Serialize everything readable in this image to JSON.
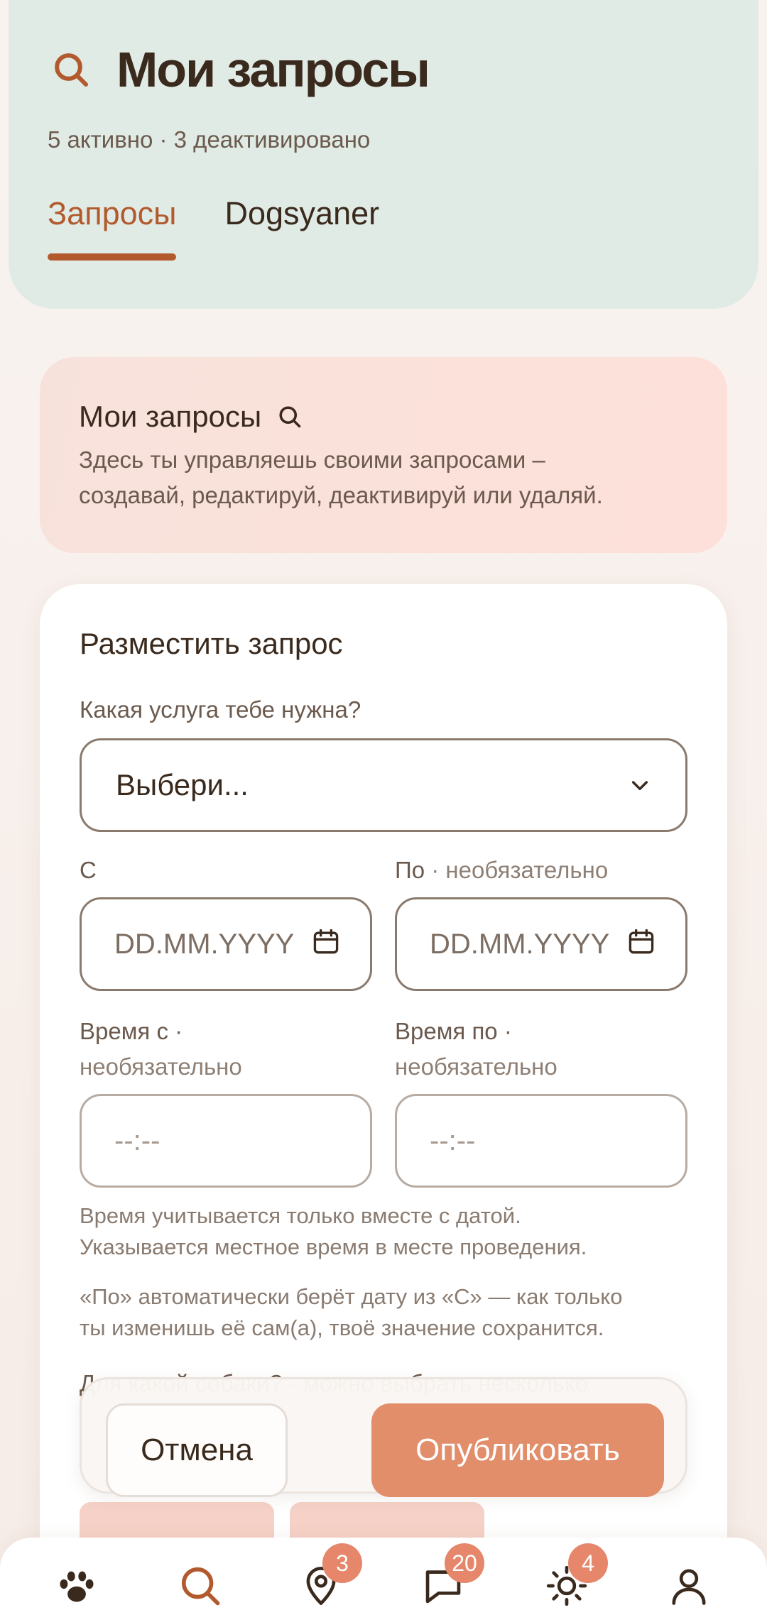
{
  "header": {
    "title": "Мои запросы",
    "subtitle": "5 активно · 3 деактивировано",
    "tabs": [
      {
        "label": "Запросы",
        "active": true
      },
      {
        "label": "Dogsyaner",
        "active": false
      }
    ]
  },
  "info": {
    "title": "Мои запросы",
    "text_line1": "Здесь ты управляешь своими запросами –",
    "text_line2": "создавай, редактируй, деактивируй или удаляй."
  },
  "form": {
    "title": "Разместить запрос",
    "service_label": "Какая услуга тебе нужна?",
    "service_value": "Выбери...",
    "from_label": "С",
    "to_label": "По",
    "to_optional": "· необязательно",
    "date_placeholder": "DD.MM.YYYY",
    "time_from_label": "Время с ·",
    "time_to_label": "Время по ·",
    "optional_word": "необязательно",
    "time_placeholder": "--:--",
    "note1_line1": "Время учитывается только вместе с датой.",
    "note1_line2": "Указывается местное время в месте проведения.",
    "note2_line1": "«По» автоматически берёт дату из «С» — как только",
    "note2_line2": "ты изменишь её сам(а), твоё значение сохранится.",
    "dog_label": "Для какой собаки? · можно выбрать несколько"
  },
  "actions": {
    "cancel": "Отмена",
    "publish": "Опубликовать"
  },
  "nav": [
    {
      "icon": "paw-icon",
      "badge": null
    },
    {
      "icon": "search-icon",
      "badge": null,
      "active": true
    },
    {
      "icon": "map-pin-icon",
      "badge": "3"
    },
    {
      "icon": "chat-icon",
      "badge": "20"
    },
    {
      "icon": "sun-icon",
      "badge": "4"
    },
    {
      "icon": "profile-icon",
      "badge": null
    }
  ],
  "colors": {
    "accent": "#b25a2e",
    "header_bg": "#e1ebe5",
    "publish_bg": "#e28e6b",
    "badge_bg": "#e6866a"
  }
}
